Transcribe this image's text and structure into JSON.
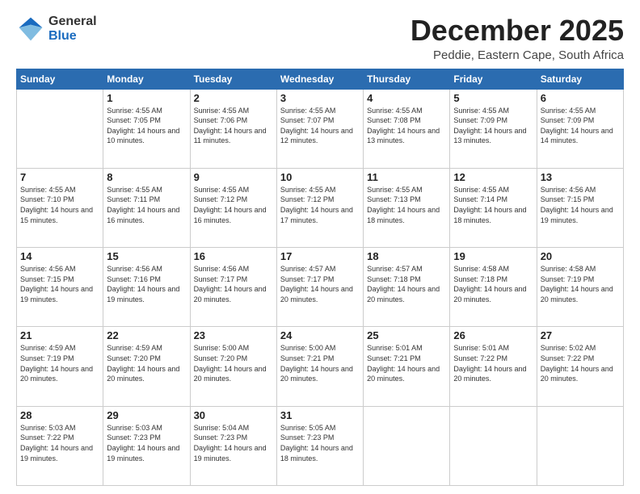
{
  "logo": {
    "line1": "General",
    "line2": "Blue"
  },
  "title": "December 2025",
  "subtitle": "Peddie, Eastern Cape, South Africa",
  "weekdays": [
    "Sunday",
    "Monday",
    "Tuesday",
    "Wednesday",
    "Thursday",
    "Friday",
    "Saturday"
  ],
  "weeks": [
    [
      {
        "day": "",
        "sunrise": "",
        "sunset": "",
        "daylight": ""
      },
      {
        "day": "1",
        "sunrise": "Sunrise: 4:55 AM",
        "sunset": "Sunset: 7:05 PM",
        "daylight": "Daylight: 14 hours and 10 minutes."
      },
      {
        "day": "2",
        "sunrise": "Sunrise: 4:55 AM",
        "sunset": "Sunset: 7:06 PM",
        "daylight": "Daylight: 14 hours and 11 minutes."
      },
      {
        "day": "3",
        "sunrise": "Sunrise: 4:55 AM",
        "sunset": "Sunset: 7:07 PM",
        "daylight": "Daylight: 14 hours and 12 minutes."
      },
      {
        "day": "4",
        "sunrise": "Sunrise: 4:55 AM",
        "sunset": "Sunset: 7:08 PM",
        "daylight": "Daylight: 14 hours and 13 minutes."
      },
      {
        "day": "5",
        "sunrise": "Sunrise: 4:55 AM",
        "sunset": "Sunset: 7:09 PM",
        "daylight": "Daylight: 14 hours and 13 minutes."
      },
      {
        "day": "6",
        "sunrise": "Sunrise: 4:55 AM",
        "sunset": "Sunset: 7:09 PM",
        "daylight": "Daylight: 14 hours and 14 minutes."
      }
    ],
    [
      {
        "day": "7",
        "sunrise": "Sunrise: 4:55 AM",
        "sunset": "Sunset: 7:10 PM",
        "daylight": "Daylight: 14 hours and 15 minutes."
      },
      {
        "day": "8",
        "sunrise": "Sunrise: 4:55 AM",
        "sunset": "Sunset: 7:11 PM",
        "daylight": "Daylight: 14 hours and 16 minutes."
      },
      {
        "day": "9",
        "sunrise": "Sunrise: 4:55 AM",
        "sunset": "Sunset: 7:12 PM",
        "daylight": "Daylight: 14 hours and 16 minutes."
      },
      {
        "day": "10",
        "sunrise": "Sunrise: 4:55 AM",
        "sunset": "Sunset: 7:12 PM",
        "daylight": "Daylight: 14 hours and 17 minutes."
      },
      {
        "day": "11",
        "sunrise": "Sunrise: 4:55 AM",
        "sunset": "Sunset: 7:13 PM",
        "daylight": "Daylight: 14 hours and 18 minutes."
      },
      {
        "day": "12",
        "sunrise": "Sunrise: 4:55 AM",
        "sunset": "Sunset: 7:14 PM",
        "daylight": "Daylight: 14 hours and 18 minutes."
      },
      {
        "day": "13",
        "sunrise": "Sunrise: 4:56 AM",
        "sunset": "Sunset: 7:15 PM",
        "daylight": "Daylight: 14 hours and 19 minutes."
      }
    ],
    [
      {
        "day": "14",
        "sunrise": "Sunrise: 4:56 AM",
        "sunset": "Sunset: 7:15 PM",
        "daylight": "Daylight: 14 hours and 19 minutes."
      },
      {
        "day": "15",
        "sunrise": "Sunrise: 4:56 AM",
        "sunset": "Sunset: 7:16 PM",
        "daylight": "Daylight: 14 hours and 19 minutes."
      },
      {
        "day": "16",
        "sunrise": "Sunrise: 4:56 AM",
        "sunset": "Sunset: 7:17 PM",
        "daylight": "Daylight: 14 hours and 20 minutes."
      },
      {
        "day": "17",
        "sunrise": "Sunrise: 4:57 AM",
        "sunset": "Sunset: 7:17 PM",
        "daylight": "Daylight: 14 hours and 20 minutes."
      },
      {
        "day": "18",
        "sunrise": "Sunrise: 4:57 AM",
        "sunset": "Sunset: 7:18 PM",
        "daylight": "Daylight: 14 hours and 20 minutes."
      },
      {
        "day": "19",
        "sunrise": "Sunrise: 4:58 AM",
        "sunset": "Sunset: 7:18 PM",
        "daylight": "Daylight: 14 hours and 20 minutes."
      },
      {
        "day": "20",
        "sunrise": "Sunrise: 4:58 AM",
        "sunset": "Sunset: 7:19 PM",
        "daylight": "Daylight: 14 hours and 20 minutes."
      }
    ],
    [
      {
        "day": "21",
        "sunrise": "Sunrise: 4:59 AM",
        "sunset": "Sunset: 7:19 PM",
        "daylight": "Daylight: 14 hours and 20 minutes."
      },
      {
        "day": "22",
        "sunrise": "Sunrise: 4:59 AM",
        "sunset": "Sunset: 7:20 PM",
        "daylight": "Daylight: 14 hours and 20 minutes."
      },
      {
        "day": "23",
        "sunrise": "Sunrise: 5:00 AM",
        "sunset": "Sunset: 7:20 PM",
        "daylight": "Daylight: 14 hours and 20 minutes."
      },
      {
        "day": "24",
        "sunrise": "Sunrise: 5:00 AM",
        "sunset": "Sunset: 7:21 PM",
        "daylight": "Daylight: 14 hours and 20 minutes."
      },
      {
        "day": "25",
        "sunrise": "Sunrise: 5:01 AM",
        "sunset": "Sunset: 7:21 PM",
        "daylight": "Daylight: 14 hours and 20 minutes."
      },
      {
        "day": "26",
        "sunrise": "Sunrise: 5:01 AM",
        "sunset": "Sunset: 7:22 PM",
        "daylight": "Daylight: 14 hours and 20 minutes."
      },
      {
        "day": "27",
        "sunrise": "Sunrise: 5:02 AM",
        "sunset": "Sunset: 7:22 PM",
        "daylight": "Daylight: 14 hours and 20 minutes."
      }
    ],
    [
      {
        "day": "28",
        "sunrise": "Sunrise: 5:03 AM",
        "sunset": "Sunset: 7:22 PM",
        "daylight": "Daylight: 14 hours and 19 minutes."
      },
      {
        "day": "29",
        "sunrise": "Sunrise: 5:03 AM",
        "sunset": "Sunset: 7:23 PM",
        "daylight": "Daylight: 14 hours and 19 minutes."
      },
      {
        "day": "30",
        "sunrise": "Sunrise: 5:04 AM",
        "sunset": "Sunset: 7:23 PM",
        "daylight": "Daylight: 14 hours and 19 minutes."
      },
      {
        "day": "31",
        "sunrise": "Sunrise: 5:05 AM",
        "sunset": "Sunset: 7:23 PM",
        "daylight": "Daylight: 14 hours and 18 minutes."
      },
      {
        "day": "",
        "sunrise": "",
        "sunset": "",
        "daylight": ""
      },
      {
        "day": "",
        "sunrise": "",
        "sunset": "",
        "daylight": ""
      },
      {
        "day": "",
        "sunrise": "",
        "sunset": "",
        "daylight": ""
      }
    ]
  ]
}
